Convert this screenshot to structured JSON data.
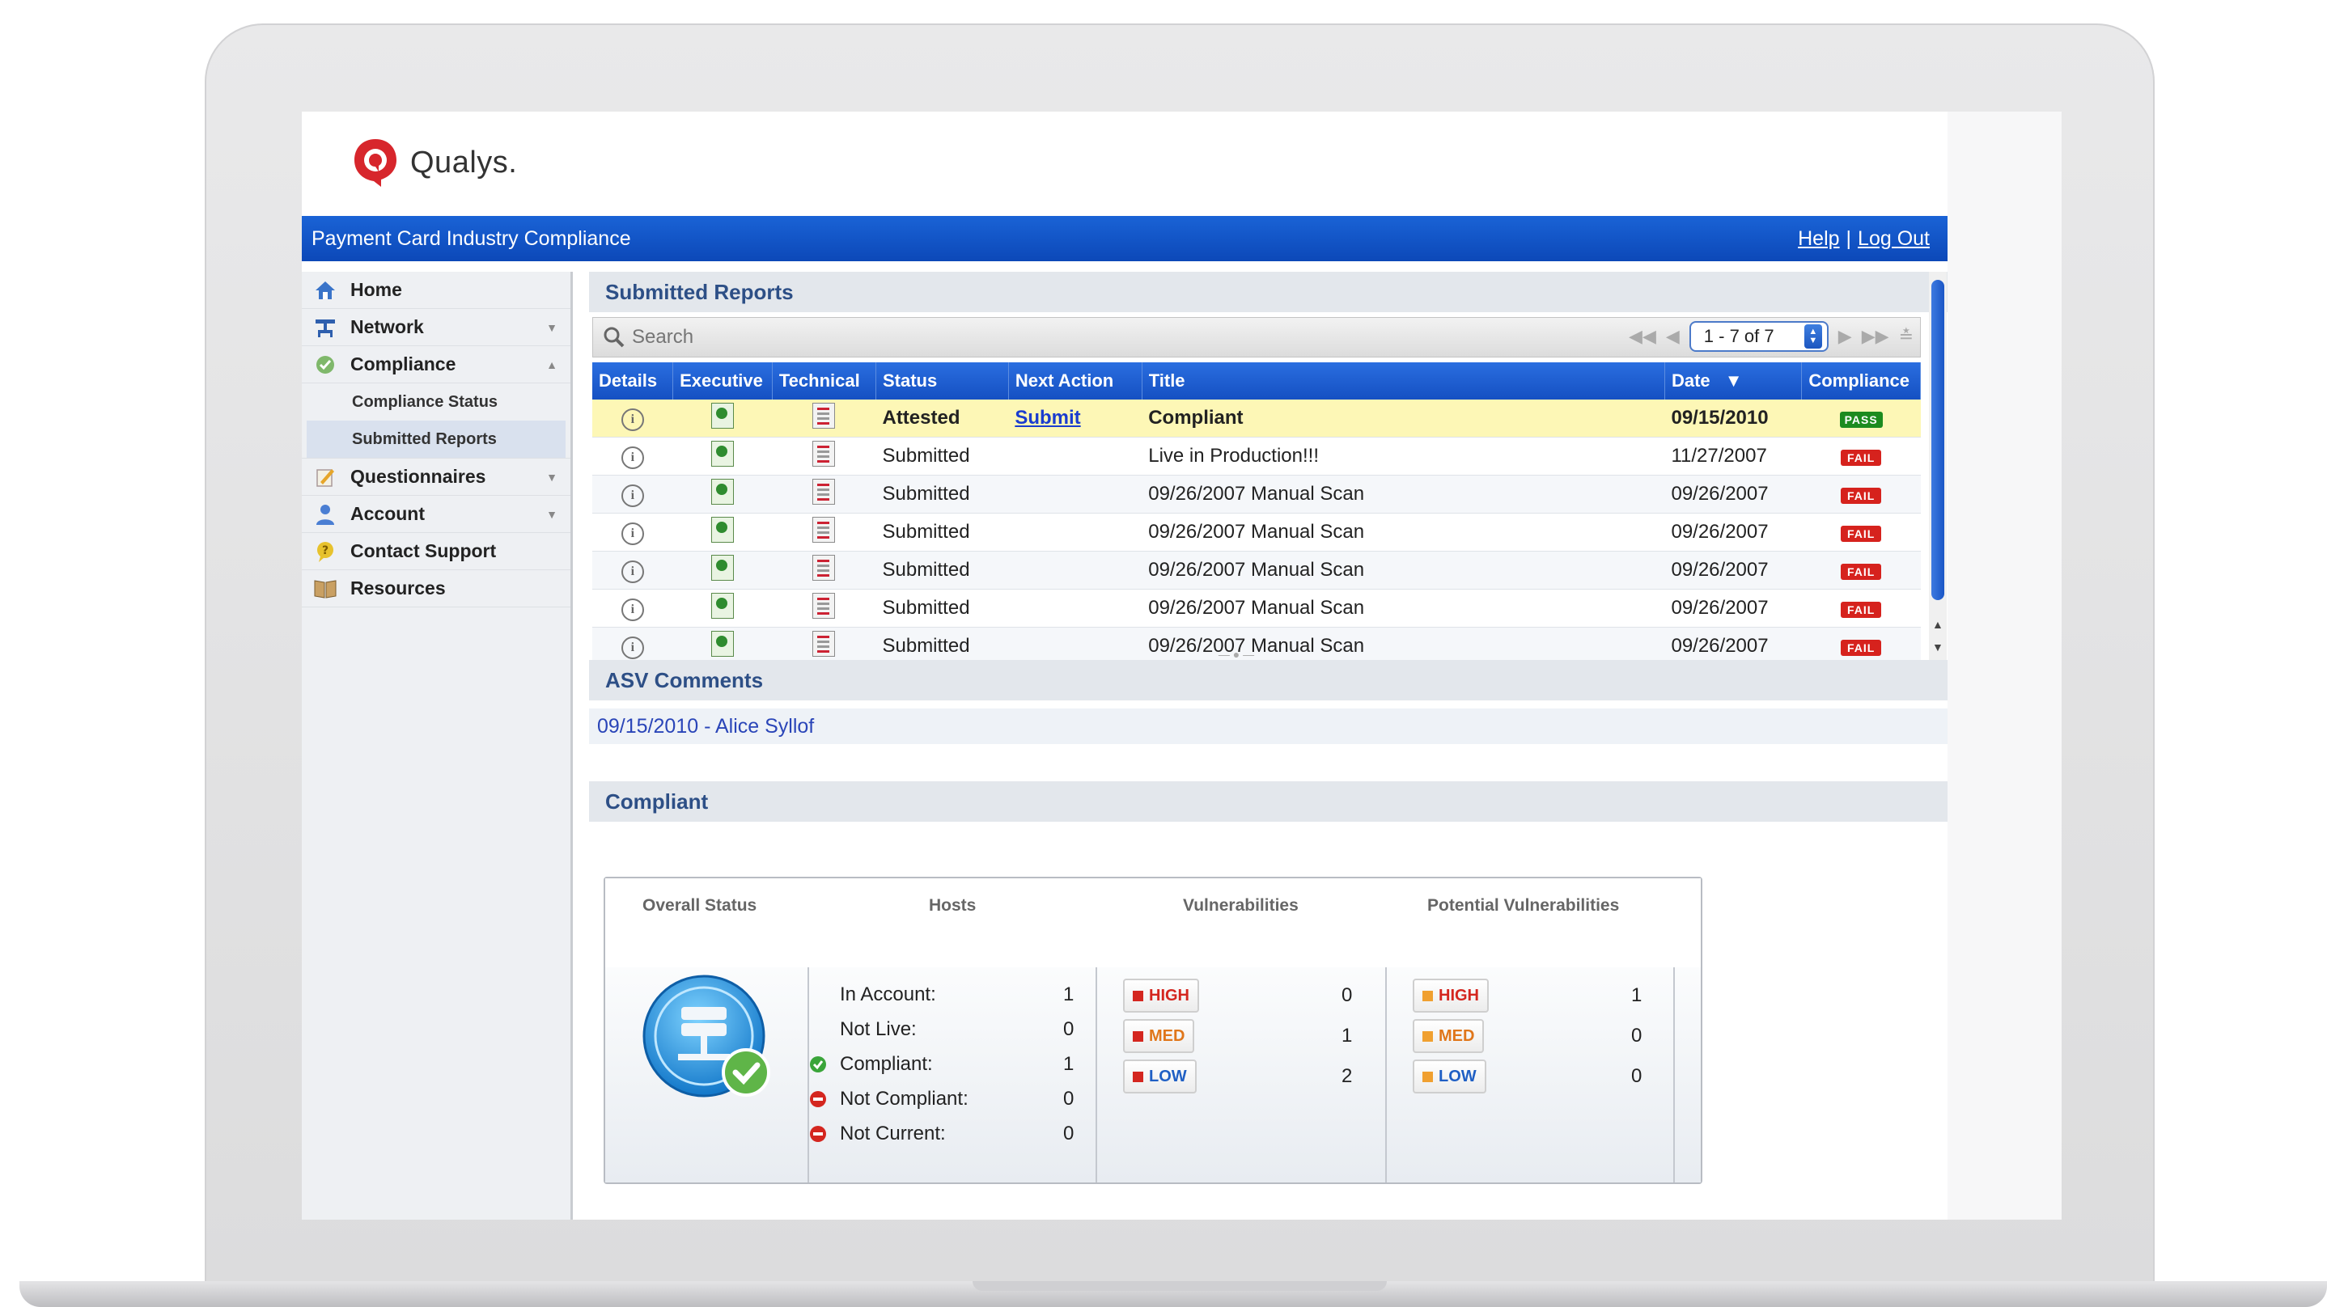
{
  "logo": {
    "text": "Qualys."
  },
  "topbar": {
    "title": "Payment Card Industry Compliance",
    "help": "Help",
    "separator": "|",
    "logout": "Log Out"
  },
  "sidebar": {
    "items": [
      {
        "label": "Home",
        "icon": "home-icon"
      },
      {
        "label": "Network",
        "icon": "network-icon"
      },
      {
        "label": "Compliance",
        "icon": "compliance-icon"
      },
      {
        "label": "Compliance Status"
      },
      {
        "label": "Submitted Reports"
      },
      {
        "label": "Questionnaires",
        "icon": "questionnaire-icon"
      },
      {
        "label": "Account",
        "icon": "user-icon"
      },
      {
        "label": "Contact Support",
        "icon": "support-icon"
      },
      {
        "label": "Resources",
        "icon": "book-icon"
      }
    ]
  },
  "reports": {
    "heading": "Submitted Reports",
    "search_placeholder": "Search",
    "pager": "1 - 7 of 7",
    "columns": [
      "Details",
      "Executive",
      "Technical",
      "Status",
      "Next Action",
      "Title",
      "Date",
      "Compliance"
    ],
    "rows": [
      {
        "status": "Attested",
        "next_action": "Submit",
        "title": "Compliant",
        "date": "09/15/2010",
        "compliance": "PASS"
      },
      {
        "status": "Submitted",
        "next_action": "",
        "title": "Live in Production!!!",
        "date": "11/27/2007",
        "compliance": "FAIL"
      },
      {
        "status": "Submitted",
        "next_action": "",
        "title": "09/26/2007 Manual Scan",
        "date": "09/26/2007",
        "compliance": "FAIL"
      },
      {
        "status": "Submitted",
        "next_action": "",
        "title": "09/26/2007 Manual Scan",
        "date": "09/26/2007",
        "compliance": "FAIL"
      },
      {
        "status": "Submitted",
        "next_action": "",
        "title": "09/26/2007 Manual Scan",
        "date": "09/26/2007",
        "compliance": "FAIL"
      },
      {
        "status": "Submitted",
        "next_action": "",
        "title": "09/26/2007 Manual Scan",
        "date": "09/26/2007",
        "compliance": "FAIL"
      },
      {
        "status": "Submitted",
        "next_action": "",
        "title": "09/26/2007 Manual Scan",
        "date": "09/26/2007",
        "compliance": "FAIL"
      }
    ]
  },
  "asv": {
    "heading": "ASV Comments",
    "comment": "09/15/2010 - Alice Syllof"
  },
  "compliant": {
    "heading": "Compliant",
    "col_overall": "Overall Status",
    "col_hosts": "Hosts",
    "col_vulns": "Vulnerabilities",
    "col_potential": "Potential Vulnerabilities",
    "hosts": [
      {
        "label": "In Account:",
        "value": "1",
        "icon": ""
      },
      {
        "label": "Not Live:",
        "value": "0",
        "icon": ""
      },
      {
        "label": "Compliant:",
        "value": "1",
        "icon": "check-green-icon"
      },
      {
        "label": "Not Compliant:",
        "value": "0",
        "icon": "minus-red-icon"
      },
      {
        "label": "Not Current:",
        "value": "0",
        "icon": "minus-red-icon"
      }
    ],
    "vulnerabilities": [
      {
        "severity": "HIGH",
        "value": "0"
      },
      {
        "severity": "MED",
        "value": "1"
      },
      {
        "severity": "LOW",
        "value": "2"
      }
    ],
    "potential": [
      {
        "severity": "HIGH",
        "value": "1"
      },
      {
        "severity": "MED",
        "value": "0"
      },
      {
        "severity": "LOW",
        "value": "0"
      }
    ]
  },
  "colors": {
    "brand_red": "#d7262c",
    "header_blue": "#1553c4",
    "pass": "#1c8b1f",
    "fail": "#d6221d",
    "highlight_row": "#fdf7b6"
  }
}
